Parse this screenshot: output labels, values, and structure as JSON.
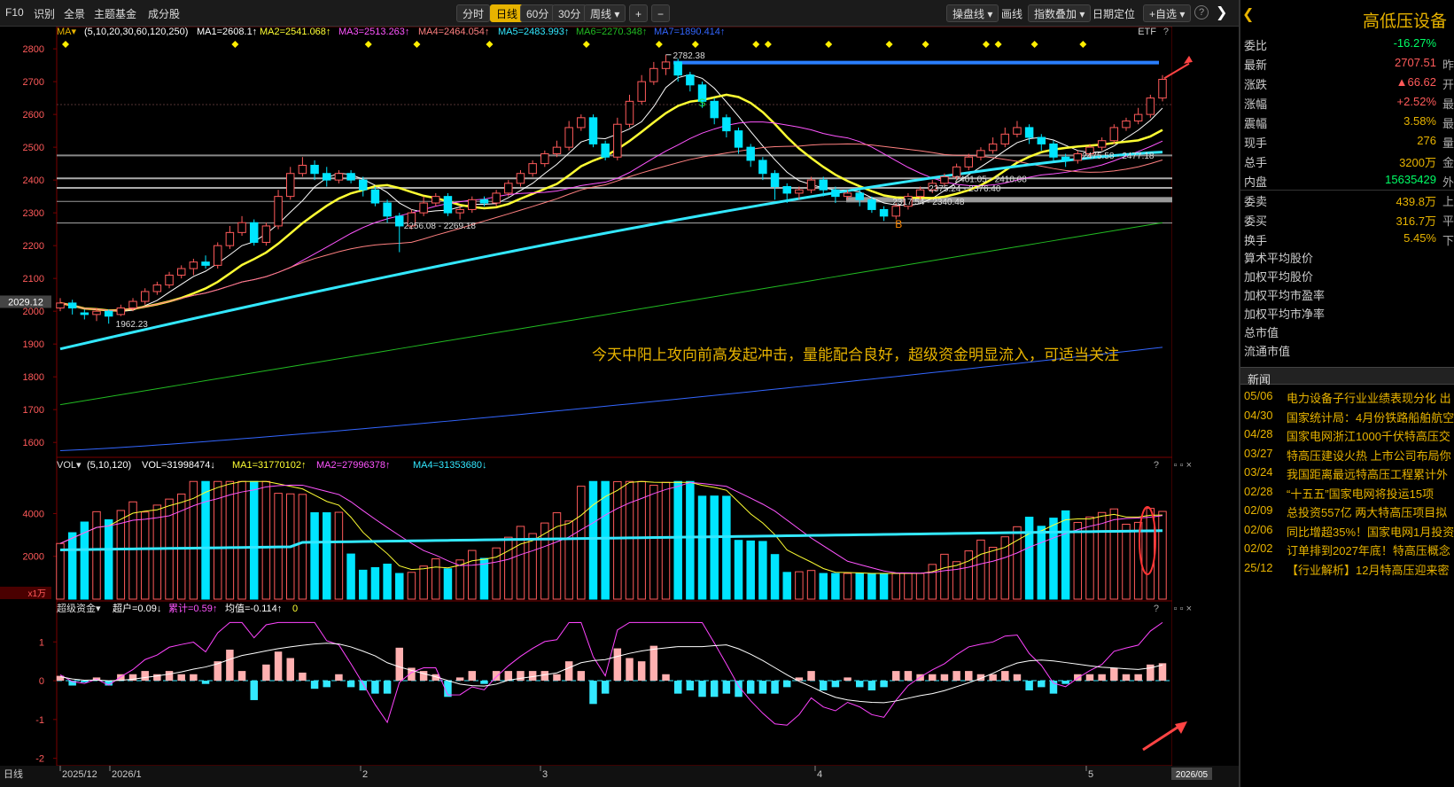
{
  "toolbar": {
    "items": [
      "F10",
      "识别",
      "全景",
      "主题基金",
      "成分股"
    ],
    "periods": [
      "分时",
      "日线",
      "60分",
      "30分",
      "周线"
    ],
    "active_period": "日线",
    "plus": "+",
    "minus": "−",
    "right_items": [
      "操盘线",
      "画线",
      "指数叠加",
      "日期定位",
      "+自选"
    ],
    "help": "?"
  },
  "ma_header": {
    "name": "MA",
    "params": "(5,10,20,30,60,120,250)",
    "ma1": "MA1=2608.1↑",
    "ma2": "MA2=2541.068↑",
    "ma3": "MA3=2513.263↑",
    "ma4": "MA4=2464.054↑",
    "ma5": "MA5=2483.993↑",
    "ma6": "MA6=2270.348↑",
    "ma7": "MA7=1890.414↑",
    "etf": "ETF",
    "help": "?"
  },
  "vol_header": {
    "name": "VOL",
    "params": "(5,10,120)",
    "vol": "VOL=31998474↓",
    "ma1": "MA1=31770102↑",
    "ma2": "MA2=27996378↑",
    "ma4": "MA4=31353680↓",
    "unit": "x1万"
  },
  "fund_header": {
    "name": "超级资金",
    "a": "超户=0.09↓",
    "b": "累计=0.59↑",
    "c": "均值=-0.114↑",
    "d": "0"
  },
  "date_axis": {
    "bottom_left": "日线",
    "labels": [
      "2025/12",
      "2026/1",
      "2",
      "3",
      "4",
      "5"
    ],
    "current": "2026/05"
  },
  "annotation": "今天中阳上攻向前高发起冲击，量能配合良好，超级资金明显流入，可适当关注",
  "price_tag": "2029.12",
  "colors": {
    "up": "#ff5a5a",
    "down": "#00e5ff",
    "ma5": "#ffffff",
    "ma10": "#ffff33",
    "ma20": "#ff55ff",
    "ma30": "#ff8080",
    "ma60": "#33e8ff",
    "ma120": "#22bb22",
    "ma250": "#3366ff",
    "accent": "#e7b300"
  },
  "chart_data": [
    {
      "type": "candlestick",
      "title": "",
      "ylim": [
        1560,
        2830
      ],
      "yticks": [
        1600,
        1700,
        1800,
        1900,
        2000,
        2100,
        2200,
        2300,
        2400,
        2500,
        2600,
        2700,
        2800
      ],
      "candles": [
        [
          2010,
          2025,
          2040,
          2000
        ],
        [
          2025,
          2010,
          2035,
          1990
        ],
        [
          1995,
          1990,
          2005,
          1975
        ],
        [
          1990,
          2000,
          2010,
          1970
        ],
        [
          2000,
          1985,
          2005,
          1962
        ],
        [
          1990,
          2010,
          2020,
          1985
        ],
        [
          2010,
          2030,
          2040,
          2000
        ],
        [
          2030,
          2060,
          2070,
          2020
        ],
        [
          2060,
          2080,
          2090,
          2050
        ],
        [
          2080,
          2110,
          2120,
          2070
        ],
        [
          2110,
          2130,
          2140,
          2100
        ],
        [
          2130,
          2150,
          2160,
          2110
        ],
        [
          2150,
          2140,
          2170,
          2130
        ],
        [
          2140,
          2200,
          2210,
          2130
        ],
        [
          2200,
          2240,
          2260,
          2190
        ],
        [
          2240,
          2270,
          2290,
          2230
        ],
        [
          2270,
          2210,
          2280,
          2200
        ],
        [
          2210,
          2260,
          2270,
          2200
        ],
        [
          2260,
          2350,
          2370,
          2250
        ],
        [
          2350,
          2420,
          2440,
          2340
        ],
        [
          2420,
          2445,
          2470,
          2410
        ],
        [
          2445,
          2420,
          2460,
          2400
        ],
        [
          2420,
          2400,
          2440,
          2380
        ],
        [
          2400,
          2420,
          2430,
          2390
        ],
        [
          2420,
          2400,
          2430,
          2390
        ],
        [
          2400,
          2370,
          2410,
          2350
        ],
        [
          2370,
          2330,
          2380,
          2320
        ],
        [
          2330,
          2290,
          2340,
          2270
        ],
        [
          2290,
          2260,
          2300,
          2180
        ],
        [
          2260,
          2300,
          2310,
          2250
        ],
        [
          2300,
          2330,
          2350,
          2290
        ],
        [
          2330,
          2350,
          2360,
          2320
        ],
        [
          2350,
          2300,
          2360,
          2290
        ],
        [
          2300,
          2310,
          2320,
          2280
        ],
        [
          2310,
          2340,
          2350,
          2300
        ],
        [
          2340,
          2330,
          2350,
          2320
        ],
        [
          2330,
          2360,
          2370,
          2320
        ],
        [
          2360,
          2390,
          2400,
          2350
        ],
        [
          2390,
          2420,
          2430,
          2380
        ],
        [
          2420,
          2450,
          2460,
          2410
        ],
        [
          2450,
          2480,
          2490,
          2440
        ],
        [
          2480,
          2500,
          2520,
          2470
        ],
        [
          2500,
          2560,
          2580,
          2490
        ],
        [
          2560,
          2590,
          2600,
          2550
        ],
        [
          2590,
          2510,
          2600,
          2500
        ],
        [
          2510,
          2470,
          2520,
          2460
        ],
        [
          2470,
          2570,
          2590,
          2460
        ],
        [
          2570,
          2640,
          2660,
          2560
        ],
        [
          2640,
          2700,
          2720,
          2630
        ],
        [
          2700,
          2740,
          2760,
          2690
        ],
        [
          2740,
          2760,
          2782,
          2720
        ],
        [
          2760,
          2720,
          2770,
          2700
        ],
        [
          2720,
          2690,
          2730,
          2670
        ],
        [
          2690,
          2640,
          2700,
          2620
        ],
        [
          2640,
          2590,
          2650,
          2570
        ],
        [
          2590,
          2550,
          2600,
          2530
        ],
        [
          2550,
          2500,
          2560,
          2480
        ],
        [
          2500,
          2460,
          2510,
          2440
        ],
        [
          2460,
          2420,
          2470,
          2400
        ],
        [
          2420,
          2380,
          2430,
          2340
        ],
        [
          2380,
          2360,
          2390,
          2330
        ],
        [
          2360,
          2370,
          2380,
          2340
        ],
        [
          2370,
          2400,
          2410,
          2360
        ],
        [
          2400,
          2370,
          2410,
          2350
        ],
        [
          2370,
          2350,
          2380,
          2330
        ],
        [
          2350,
          2360,
          2370,
          2340
        ],
        [
          2360,
          2340,
          2370,
          2320
        ],
        [
          2340,
          2310,
          2350,
          2300
        ],
        [
          2310,
          2290,
          2320,
          2275
        ],
        [
          2290,
          2320,
          2330,
          2280
        ],
        [
          2320,
          2350,
          2360,
          2310
        ],
        [
          2350,
          2370,
          2380,
          2340
        ],
        [
          2370,
          2390,
          2400,
          2360
        ],
        [
          2390,
          2410,
          2420,
          2380
        ],
        [
          2410,
          2440,
          2450,
          2400
        ],
        [
          2440,
          2470,
          2480,
          2430
        ],
        [
          2470,
          2490,
          2500,
          2460
        ],
        [
          2490,
          2510,
          2530,
          2480
        ],
        [
          2510,
          2540,
          2560,
          2500
        ],
        [
          2540,
          2560,
          2580,
          2530
        ],
        [
          2560,
          2530,
          2570,
          2510
        ],
        [
          2530,
          2510,
          2540,
          2490
        ],
        [
          2510,
          2470,
          2520,
          2460
        ],
        [
          2470,
          2460,
          2480,
          2440
        ],
        [
          2460,
          2480,
          2490,
          2450
        ],
        [
          2480,
          2500,
          2510,
          2470
        ],
        [
          2500,
          2520,
          2530,
          2490
        ],
        [
          2520,
          2560,
          2570,
          2510
        ],
        [
          2560,
          2580,
          2590,
          2550
        ],
        [
          2580,
          2600,
          2620,
          2570
        ],
        [
          2600,
          2650,
          2660,
          2590
        ],
        [
          2650,
          2707,
          2720,
          2640
        ]
      ],
      "labels": [
        "2782.38",
        "1962.23",
        "2256.08 - 2269.18",
        "2475.58 - 2477.18",
        "2401.05 - 2410.08",
        "2375.24 - 2376.40",
        "2317.54 - 2340.48"
      ],
      "markers": [
        "S",
        "B"
      ]
    },
    {
      "type": "bar",
      "title": "VOL",
      "yticks": [
        2000,
        4000
      ],
      "ylim": [
        0,
        5800
      ]
    },
    {
      "type": "bar",
      "title": "超级资金",
      "yticks": [
        1,
        0,
        -1,
        -2
      ],
      "ylim": [
        -2.1,
        1.6
      ]
    }
  ],
  "right": {
    "title": "高低压设备",
    "rows": [
      {
        "k": "委比",
        "v": "-16.27%",
        "c": "#00ff66",
        "x": ""
      },
      {
        "k": "最新",
        "v": "2707.51",
        "c": "#ff5a5a",
        "x": "昨"
      },
      {
        "k": "涨跌",
        "v": "▲66.62",
        "c": "#ff5a5a",
        "x": "开"
      },
      {
        "k": "涨幅",
        "v": "+2.52%",
        "c": "#ff5a5a",
        "x": "最"
      },
      {
        "k": "震幅",
        "v": "3.58%",
        "c": "#e7b300",
        "x": "最"
      },
      {
        "k": "现手",
        "v": "276",
        "c": "#e7b300",
        "x": "量"
      },
      {
        "k": "总手",
        "v": "3200万",
        "c": "#e7b300",
        "x": "金"
      },
      {
        "k": "内盘",
        "v": "15635429",
        "c": "#00ff66",
        "x": "外"
      }
    ],
    "rows2": [
      {
        "k": "委卖",
        "v": "439.8万",
        "c": "#e7b300",
        "x": "上"
      },
      {
        "k": "委买",
        "v": "316.7万",
        "c": "#e7b300",
        "x": "平"
      },
      {
        "k": "换手",
        "v": "5.45%",
        "c": "#e7b300",
        "x": "下"
      }
    ],
    "labels": [
      "算术平均股价",
      "加权平均股价",
      "加权平均市盈率",
      "加权平均市净率",
      "总市值",
      "流通市值"
    ],
    "news_title": "新闻",
    "news": [
      {
        "d": "05/06",
        "t": "电力设备子行业业绩表现分化 出"
      },
      {
        "d": "04/30",
        "t": "国家统计局：4月份铁路船舶航空"
      },
      {
        "d": "04/28",
        "t": "国家电网浙江1000千伏特高压交"
      },
      {
        "d": "03/27",
        "t": "特高压建设火热 上市公司布局你"
      },
      {
        "d": "03/24",
        "t": "我国距离最远特高压工程累计外"
      },
      {
        "d": "02/28",
        "t": "“十五五”国家电网将投运15项"
      },
      {
        "d": "02/09",
        "t": "总投资557亿 两大特高压项目拟"
      },
      {
        "d": "02/06",
        "t": "同比增超35%！国家电网1月投资"
      },
      {
        "d": "02/02",
        "t": "订单排到2027年底！特高压概念"
      },
      {
        "d": "25/12",
        "t": "【行业解析】12月特高压迎来密"
      }
    ]
  }
}
